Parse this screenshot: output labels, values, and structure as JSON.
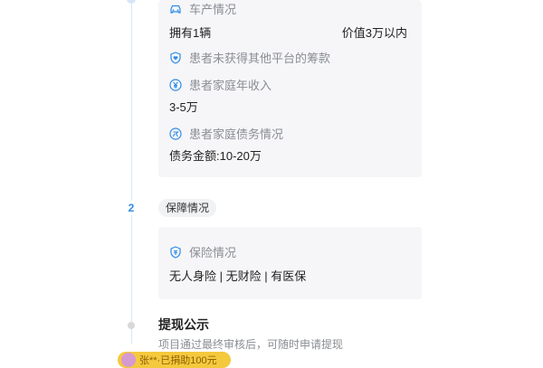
{
  "colors": {
    "accent": "#2d8ce8",
    "card_bg": "#f6f6f8",
    "label_grey": "#8a8d93",
    "chip_yellow": "#f5c93e"
  },
  "card1": {
    "car": {
      "icon": "car-icon",
      "label": "车产情况",
      "value": "拥有1辆",
      "value_right": "价值3万以内"
    },
    "crowdfunding": {
      "icon": "heart-shield-icon",
      "label": "患者未获得其他平台的筹款"
    },
    "income": {
      "icon": "yen-icon",
      "label": "患者家庭年收入",
      "value": "3-5万"
    },
    "debt": {
      "icon": "debt-icon",
      "label": "患者家庭债务情况",
      "value": "债务金额:10-20万"
    }
  },
  "step2": {
    "number": "2",
    "title": "保障情况"
  },
  "card2": {
    "insurance": {
      "icon": "insurance-icon",
      "label": "保险情况",
      "value": "无人身险 | 无财险 | 有医保"
    }
  },
  "withdraw": {
    "title": "提现公示",
    "subtitle": "项目通过最终审核后，可随时申请提现"
  },
  "bottom_chip": {
    "text": "张**·已捐助100元"
  }
}
